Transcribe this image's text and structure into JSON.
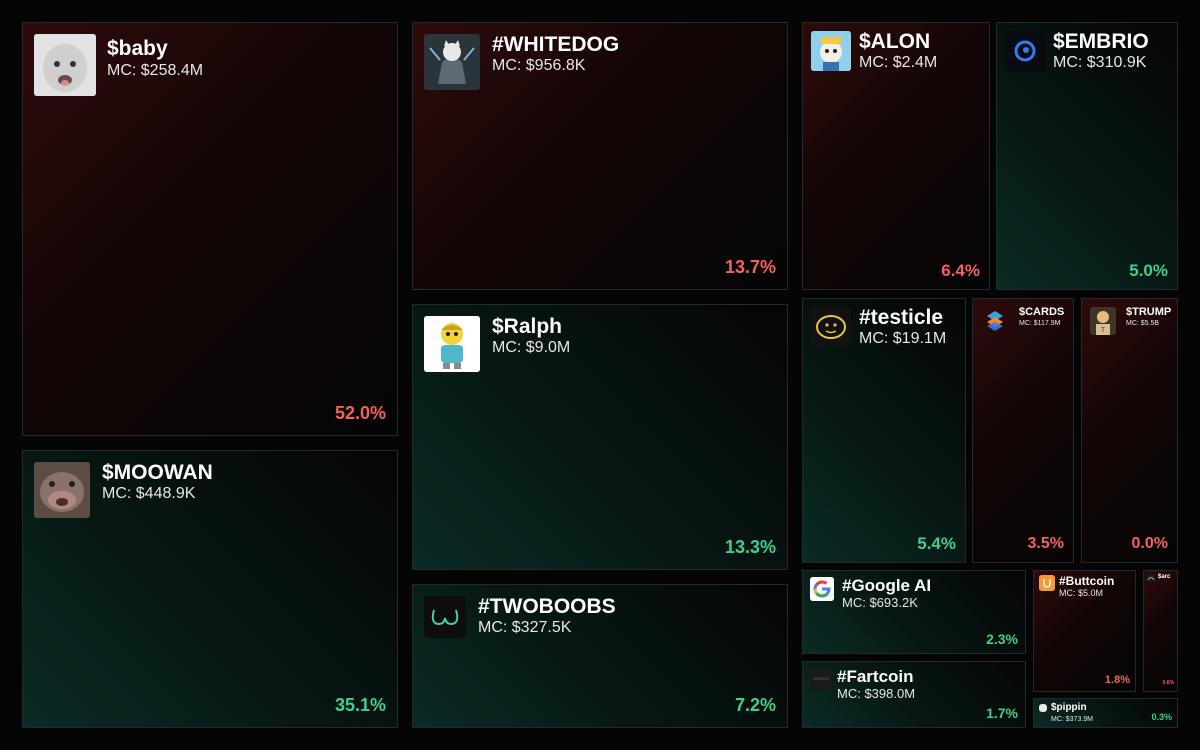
{
  "tiles": {
    "baby": {
      "name": "$baby",
      "mc": "MC: $258.4M",
      "pct": "52.0%",
      "trend": "down",
      "icon": "baby-face-icon"
    },
    "moowan": {
      "name": "$MOOWAN",
      "mc": "MC: $448.9K",
      "pct": "35.1%",
      "trend": "up",
      "icon": "hippo-icon"
    },
    "whitedog": {
      "name": "#WHITEDOG",
      "mc": "MC: $956.8K",
      "pct": "13.7%",
      "trend": "down",
      "icon": "armored-dog-icon"
    },
    "ralph": {
      "name": "$Ralph",
      "mc": "MC: $9.0M",
      "pct": "13.3%",
      "trend": "up",
      "icon": "ralph-cartoon-icon"
    },
    "twoboobs": {
      "name": "#TWOBOOBS",
      "mc": "MC: $327.5K",
      "pct": "7.2%",
      "trend": "up",
      "icon": "curves-icon"
    },
    "alon": {
      "name": "$ALON",
      "mc": "MC: $2.4M",
      "pct": "6.4%",
      "trend": "down",
      "icon": "cartoon-character-icon"
    },
    "embrio": {
      "name": "$EMBRIO",
      "mc": "MC: $310.9K",
      "pct": "5.0%",
      "trend": "up",
      "icon": "embryo-icon"
    },
    "testicle": {
      "name": "#testicle",
      "mc": "MC: $19.1M",
      "pct": "5.4%",
      "trend": "up",
      "icon": "smiley-face-icon"
    },
    "cards": {
      "name": "$CARDS",
      "mc": "MC: $117.9M",
      "pct": "3.5%",
      "trend": "down",
      "icon": "stacked-cards-icon"
    },
    "trump": {
      "name": "$TRUMP",
      "mc": "MC: $5.5B",
      "pct": "0.0%",
      "trend": "down",
      "icon": "trump-icon"
    },
    "google": {
      "name": "#Google AI",
      "mc": "MC: $693.2K",
      "pct": "2.3%",
      "trend": "up",
      "icon": "google-logo-icon"
    },
    "fartcoin": {
      "name": "#Fartcoin",
      "mc": "MC: $398.0M",
      "pct": "1.7%",
      "trend": "up",
      "icon": "fartcoin-icon"
    },
    "buttcoin": {
      "name": "#Buttcoin",
      "mc": "MC: $5.0M",
      "pct": "1.8%",
      "trend": "down",
      "icon": "buttcoin-icon"
    },
    "arc": {
      "name": "$arc",
      "mc": "",
      "pct": "0.6%",
      "trend": "down",
      "icon": "arc-icon"
    },
    "pippin": {
      "name": "$pippin",
      "mc": "MC: $373.9M",
      "pct": "0.3%",
      "trend": "up",
      "icon": "pippin-icon"
    }
  },
  "colors": {
    "up": "#3fcf8e",
    "down": "#f1635f",
    "border": "#24292c",
    "background": "#050505"
  }
}
